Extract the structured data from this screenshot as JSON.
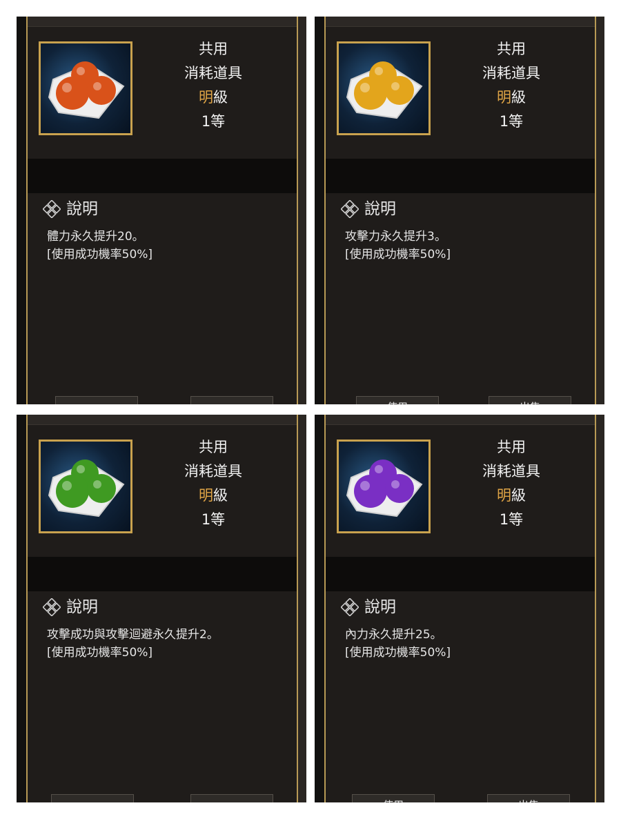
{
  "panels": [
    {
      "category": "共用",
      "type": "消耗道具",
      "grade_highlight": "明",
      "grade_suffix": "級",
      "level": "1等",
      "orb_color": "orange",
      "orb_hex": "#d9521a",
      "section_title": "說明",
      "desc_line1": "體力永久提升20。",
      "desc_line2": "[使用成功機率50%]",
      "button_left": "",
      "button_right": ""
    },
    {
      "category": "共用",
      "type": "消耗道具",
      "grade_highlight": "明",
      "grade_suffix": "級",
      "level": "1等",
      "orb_color": "gold",
      "orb_hex": "#e3a51c",
      "section_title": "說明",
      "desc_line1": "攻擊力永久提升3。",
      "desc_line2": "[使用成功機率50%]",
      "button_left": "使用",
      "button_right": "出售"
    },
    {
      "category": "共用",
      "type": "消耗道具",
      "grade_highlight": "明",
      "grade_suffix": "級",
      "level": "1等",
      "orb_color": "green",
      "orb_hex": "#3f9a22",
      "section_title": "說明",
      "desc_line1": "攻擊成功與攻擊迴避永久提升2。",
      "desc_line2": "[使用成功機率50%]",
      "button_left": "",
      "button_right": ""
    },
    {
      "category": "共用",
      "type": "消耗道具",
      "grade_highlight": "明",
      "grade_suffix": "級",
      "level": "1等",
      "orb_color": "purple",
      "orb_hex": "#7a2fc4",
      "section_title": "說明",
      "desc_line1": "內力永久提升25。",
      "desc_line2": "[使用成功機率50%]",
      "button_left": "使用",
      "button_right": "出售"
    }
  ],
  "colors": {
    "panel_bg": "#1f1c1a",
    "gold_rail": "#b89a55",
    "grade_accent": "#e0a546"
  }
}
